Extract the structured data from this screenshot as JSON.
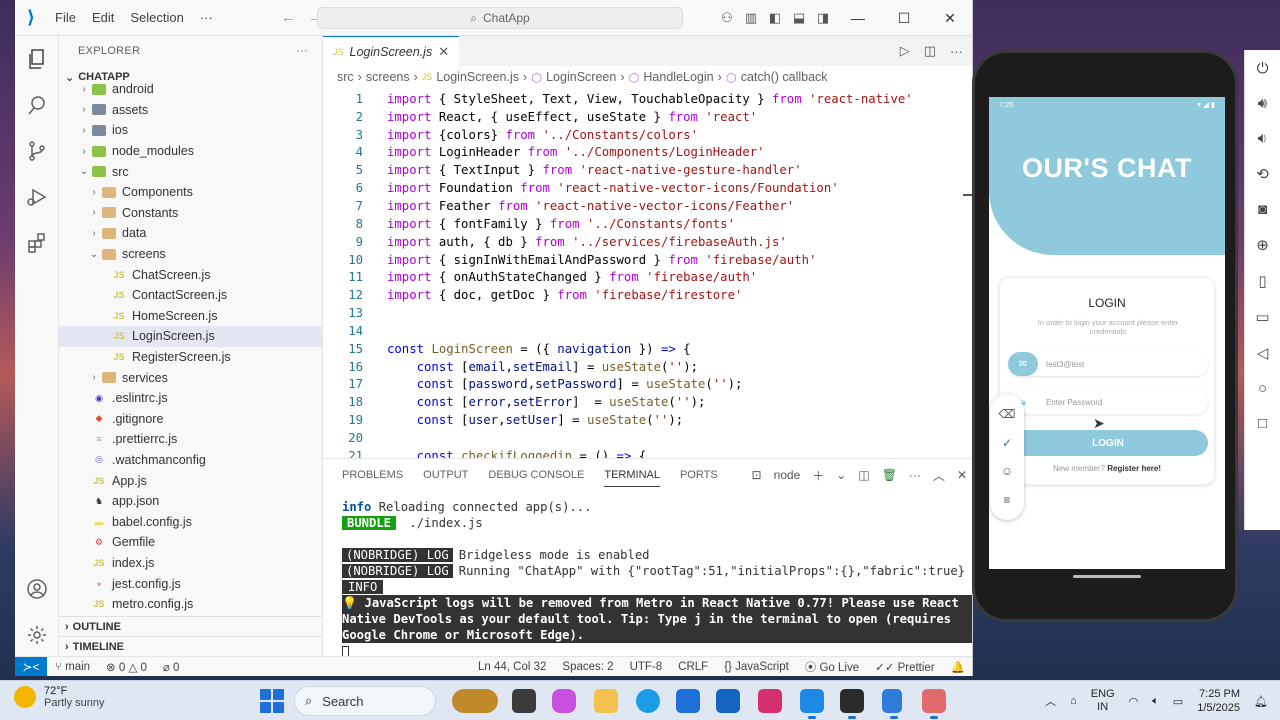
{
  "titlebar": {
    "menus": [
      "File",
      "Edit",
      "Selection",
      "···"
    ],
    "search": "ChatApp"
  },
  "explorer": {
    "header": "EXPLORER",
    "project": "CHATAPP",
    "items": [
      {
        "label": "android",
        "depth": 1,
        "kind": "folder-green",
        "chevron": "›"
      },
      {
        "label": "assets",
        "depth": 1,
        "kind": "folder-gray",
        "chevron": "›"
      },
      {
        "label": "ios",
        "depth": 1,
        "kind": "folder-gray",
        "chevron": "›"
      },
      {
        "label": "node_modules",
        "depth": 1,
        "kind": "folder-green",
        "chevron": "›"
      },
      {
        "label": "src",
        "depth": 1,
        "kind": "folder-green",
        "chevron": "⌄"
      },
      {
        "label": "Components",
        "depth": 2,
        "kind": "folder",
        "chevron": "›"
      },
      {
        "label": "Constants",
        "depth": 2,
        "kind": "folder",
        "chevron": "›"
      },
      {
        "label": "data",
        "depth": 2,
        "kind": "folder",
        "chevron": "›"
      },
      {
        "label": "screens",
        "depth": 2,
        "kind": "folder",
        "chevron": "⌄"
      },
      {
        "label": "ChatScreen.js",
        "depth": 3,
        "kind": "js",
        "chevron": ""
      },
      {
        "label": "ContactScreen.js",
        "depth": 3,
        "kind": "js",
        "chevron": ""
      },
      {
        "label": "HomeScreen.js",
        "depth": 3,
        "kind": "js",
        "chevron": ""
      },
      {
        "label": "LoginScreen.js",
        "depth": 3,
        "kind": "js",
        "chevron": "",
        "selected": true
      },
      {
        "label": "RegisterScreen.js",
        "depth": 3,
        "kind": "js",
        "chevron": ""
      },
      {
        "label": "services",
        "depth": 2,
        "kind": "folder",
        "chevron": "›"
      },
      {
        "label": ".eslintrc.js",
        "depth": 1,
        "kind": "eslint",
        "chevron": ""
      },
      {
        "label": ".gitignore",
        "depth": 1,
        "kind": "git",
        "chevron": ""
      },
      {
        "label": ".prettierrc.js",
        "depth": 1,
        "kind": "file",
        "chevron": ""
      },
      {
        "label": ".watchmanconfig",
        "depth": 1,
        "kind": "watch",
        "chevron": ""
      },
      {
        "label": "App.js",
        "depth": 1,
        "kind": "js",
        "chevron": ""
      },
      {
        "label": "app.json",
        "depth": 1,
        "kind": "json",
        "chevron": ""
      },
      {
        "label": "babel.config.js",
        "depth": 1,
        "kind": "babel",
        "chevron": ""
      },
      {
        "label": "Gemfile",
        "depth": 1,
        "kind": "gem",
        "chevron": ""
      },
      {
        "label": "index.js",
        "depth": 1,
        "kind": "js",
        "chevron": ""
      },
      {
        "label": "jest.config.js",
        "depth": 1,
        "kind": "jest",
        "chevron": ""
      },
      {
        "label": "metro.config.js",
        "depth": 1,
        "kind": "js",
        "chevron": ""
      }
    ],
    "outline": "OUTLINE",
    "timeline": "TIMELINE"
  },
  "editor": {
    "tab": "LoginScreen.js",
    "breadcrumb": [
      "src",
      "screens",
      "LoginScreen.js",
      "LoginScreen",
      "HandleLogin",
      "catch() callback"
    ],
    "lines": [
      {
        "n": "1",
        "t": [
          [
            "kw",
            "import"
          ],
          [
            "cc",
            " { StyleSheet, Text, View, TouchableOpacity } "
          ],
          [
            "kw",
            "from"
          ],
          [
            "str",
            " 'react-native'"
          ]
        ]
      },
      {
        "n": "2",
        "t": [
          [
            "kw",
            "import"
          ],
          [
            "cc",
            " React, { useEffect, useState } "
          ],
          [
            "kw",
            "from"
          ],
          [
            "str",
            " 'react'"
          ]
        ]
      },
      {
        "n": "3",
        "t": [
          [
            "kw",
            "import"
          ],
          [
            "cc",
            " {colors} "
          ],
          [
            "kw",
            "from"
          ],
          [
            "str",
            " '../Constants/colors'"
          ]
        ]
      },
      {
        "n": "4",
        "t": [
          [
            "kw",
            "import"
          ],
          [
            "cc",
            " LoginHeader "
          ],
          [
            "kw",
            "from"
          ],
          [
            "str",
            " '../Components/LoginHeader'"
          ]
        ]
      },
      {
        "n": "5",
        "t": [
          [
            "kw",
            "import"
          ],
          [
            "cc",
            " { TextInput } "
          ],
          [
            "kw",
            "from"
          ],
          [
            "str",
            " 'react-native-gesture-handler'"
          ]
        ]
      },
      {
        "n": "6",
        "t": [
          [
            "kw",
            "import"
          ],
          [
            "cc",
            " Foundation "
          ],
          [
            "kw",
            "from"
          ],
          [
            "str",
            " 'react-native-vector-icons/Foundation'"
          ]
        ]
      },
      {
        "n": "7",
        "t": [
          [
            "kw",
            "import"
          ],
          [
            "cc",
            " Feather "
          ],
          [
            "kw",
            "from"
          ],
          [
            "str",
            " 'react-native-vector-icons/Feather'"
          ]
        ]
      },
      {
        "n": "8",
        "t": [
          [
            "kw",
            "import"
          ],
          [
            "cc",
            " { fontFamily } "
          ],
          [
            "kw",
            "from"
          ],
          [
            "str",
            " '../Constants/fonts'"
          ]
        ]
      },
      {
        "n": "9",
        "t": [
          [
            "kw",
            "import"
          ],
          [
            "cc",
            " auth, { db } "
          ],
          [
            "kw",
            "from"
          ],
          [
            "str",
            " '../services/firebaseAuth.js'"
          ]
        ]
      },
      {
        "n": "10",
        "t": [
          [
            "kw",
            "import"
          ],
          [
            "cc",
            " { signInWithEmailAndPassword } "
          ],
          [
            "kw",
            "from"
          ],
          [
            "str",
            " 'firebase/auth'"
          ]
        ]
      },
      {
        "n": "11",
        "t": [
          [
            "kw",
            "import"
          ],
          [
            "cc",
            " { onAuthStateChanged } "
          ],
          [
            "kw",
            "from"
          ],
          [
            "str",
            " 'firebase/auth'"
          ]
        ]
      },
      {
        "n": "12",
        "t": [
          [
            "kw",
            "import"
          ],
          [
            "cc",
            " { doc, getDoc } "
          ],
          [
            "kw",
            "from"
          ],
          [
            "str",
            " 'firebase/firestore'"
          ]
        ]
      },
      {
        "n": "13",
        "t": []
      },
      {
        "n": "14",
        "t": []
      },
      {
        "n": "15",
        "t": [
          [
            "kw2",
            "const"
          ],
          [
            "cc",
            " "
          ],
          [
            "fn",
            "LoginScreen"
          ],
          [
            "cc",
            " = ({ "
          ],
          [
            "var",
            "navigation"
          ],
          [
            "cc",
            " }) "
          ],
          [
            "kw2",
            "=>"
          ],
          [
            "cc",
            " {"
          ]
        ]
      },
      {
        "n": "16",
        "t": [
          [
            "cc",
            "    "
          ],
          [
            "kw2",
            "const"
          ],
          [
            "cc",
            " ["
          ],
          [
            "var",
            "email"
          ],
          [
            "cc",
            ","
          ],
          [
            "var",
            "setEmail"
          ],
          [
            "cc",
            "] = "
          ],
          [
            "fn",
            "useState"
          ],
          [
            "cc",
            "("
          ],
          [
            "str",
            "''"
          ],
          [
            "cc",
            ");"
          ]
        ]
      },
      {
        "n": "17",
        "t": [
          [
            "cc",
            "    "
          ],
          [
            "kw2",
            "const"
          ],
          [
            "cc",
            " ["
          ],
          [
            "var",
            "password"
          ],
          [
            "cc",
            ","
          ],
          [
            "var",
            "setPassword"
          ],
          [
            "cc",
            "] = "
          ],
          [
            "fn",
            "useState"
          ],
          [
            "cc",
            "("
          ],
          [
            "str",
            "''"
          ],
          [
            "cc",
            ");"
          ]
        ]
      },
      {
        "n": "18",
        "t": [
          [
            "cc",
            "    "
          ],
          [
            "kw2",
            "const"
          ],
          [
            "cc",
            " ["
          ],
          [
            "var",
            "error"
          ],
          [
            "cc",
            ","
          ],
          [
            "var",
            "setError"
          ],
          [
            "cc",
            "]  = "
          ],
          [
            "fn",
            "useState"
          ],
          [
            "cc",
            "("
          ],
          [
            "str",
            "''"
          ],
          [
            "cc",
            ");"
          ]
        ]
      },
      {
        "n": "19",
        "t": [
          [
            "cc",
            "    "
          ],
          [
            "kw2",
            "const"
          ],
          [
            "cc",
            " ["
          ],
          [
            "var",
            "user"
          ],
          [
            "cc",
            ","
          ],
          [
            "var",
            "setUser"
          ],
          [
            "cc",
            "] = "
          ],
          [
            "fn",
            "useState"
          ],
          [
            "cc",
            "("
          ],
          [
            "str",
            "''"
          ],
          [
            "cc",
            ");"
          ]
        ]
      },
      {
        "n": "20",
        "t": []
      },
      {
        "n": "21",
        "t": [
          [
            "cc",
            "    "
          ],
          [
            "kw2",
            "const"
          ],
          [
            "cc",
            " "
          ],
          [
            "fn",
            "checkifLoggedin"
          ],
          [
            "cc",
            " = () "
          ],
          [
            "kw2",
            "=>"
          ],
          [
            "cc",
            " {"
          ]
        ]
      }
    ]
  },
  "panel": {
    "tabs": [
      "PROBLEMS",
      "OUTPUT",
      "DEBUG CONSOLE",
      "TERMINAL",
      "PORTS"
    ],
    "active_tab": "TERMINAL",
    "shell": "node",
    "terminal": {
      "l1_info": "info",
      "l1_text": " Reloading connected app(s)...",
      "l2_badge": "BUNDLE",
      "l2_text": " ./index.js",
      "nobridge": "(NOBRIDGE) LOG",
      "l3_text": "Bridgeless mode is enabled",
      "l4_text": "Running \"ChatApp\" with {\"rootTag\":51,\"initialProps\":{},\"fabric\":true}",
      "info_badge": "INFO",
      "warning": "💡 JavaScript logs will be removed from Metro in React Native 0.77! Please use React Native DevTools as your default tool. Tip: Type j in the terminal to open (requires Google Chrome or Microsoft Edge)."
    }
  },
  "statusbar": {
    "branch": "main",
    "errors": "⊗ 0 △ 0",
    "ports": "⌀ 0",
    "position": "Ln 44, Col 32",
    "spaces": "Spaces: 2",
    "encoding": "UTF-8",
    "eol": "CRLF",
    "language": "JavaScript",
    "golive": "Go Live",
    "prettier": "Prettier"
  },
  "phone": {
    "time": "7:25",
    "brand": "OUR'S CHAT",
    "login_title": "LOGIN",
    "login_sub": "In order to login your account please enter credentials",
    "email_value": "test3@test",
    "password_placeholder": "Enter Password",
    "login_button": "LOGIN",
    "register_prompt": "New member?",
    "register_link": "Register here!"
  },
  "taskbar": {
    "temp": "72°F",
    "condition": "Partly sunny",
    "search": "Search",
    "lang_top": "ENG",
    "lang_bottom": "IN",
    "time": "7:25 PM",
    "date": "1/5/2025"
  },
  "colors": {
    "accent": "#007acc",
    "phone_theme": "#8fc9dc"
  }
}
